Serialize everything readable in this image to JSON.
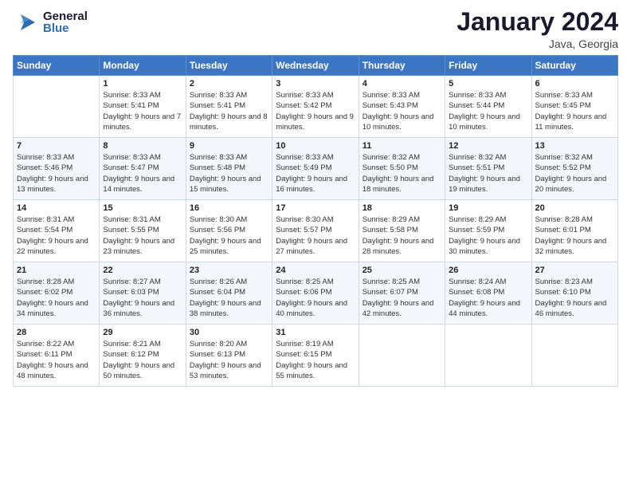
{
  "header": {
    "logo_general": "General",
    "logo_blue": "Blue",
    "month_title": "January 2024",
    "subtitle": "Java, Georgia"
  },
  "weekdays": [
    "Sunday",
    "Monday",
    "Tuesday",
    "Wednesday",
    "Thursday",
    "Friday",
    "Saturday"
  ],
  "weeks": [
    [
      {
        "day": "",
        "sunrise": "",
        "sunset": "",
        "daylight": ""
      },
      {
        "day": "1",
        "sunrise": "Sunrise: 8:33 AM",
        "sunset": "Sunset: 5:41 PM",
        "daylight": "Daylight: 9 hours and 7 minutes."
      },
      {
        "day": "2",
        "sunrise": "Sunrise: 8:33 AM",
        "sunset": "Sunset: 5:41 PM",
        "daylight": "Daylight: 9 hours and 8 minutes."
      },
      {
        "day": "3",
        "sunrise": "Sunrise: 8:33 AM",
        "sunset": "Sunset: 5:42 PM",
        "daylight": "Daylight: 9 hours and 9 minutes."
      },
      {
        "day": "4",
        "sunrise": "Sunrise: 8:33 AM",
        "sunset": "Sunset: 5:43 PM",
        "daylight": "Daylight: 9 hours and 10 minutes."
      },
      {
        "day": "5",
        "sunrise": "Sunrise: 8:33 AM",
        "sunset": "Sunset: 5:44 PM",
        "daylight": "Daylight: 9 hours and 10 minutes."
      },
      {
        "day": "6",
        "sunrise": "Sunrise: 8:33 AM",
        "sunset": "Sunset: 5:45 PM",
        "daylight": "Daylight: 9 hours and 11 minutes."
      }
    ],
    [
      {
        "day": "7",
        "sunrise": "Sunrise: 8:33 AM",
        "sunset": "Sunset: 5:46 PM",
        "daylight": "Daylight: 9 hours and 13 minutes."
      },
      {
        "day": "8",
        "sunrise": "Sunrise: 8:33 AM",
        "sunset": "Sunset: 5:47 PM",
        "daylight": "Daylight: 9 hours and 14 minutes."
      },
      {
        "day": "9",
        "sunrise": "Sunrise: 8:33 AM",
        "sunset": "Sunset: 5:48 PM",
        "daylight": "Daylight: 9 hours and 15 minutes."
      },
      {
        "day": "10",
        "sunrise": "Sunrise: 8:33 AM",
        "sunset": "Sunset: 5:49 PM",
        "daylight": "Daylight: 9 hours and 16 minutes."
      },
      {
        "day": "11",
        "sunrise": "Sunrise: 8:32 AM",
        "sunset": "Sunset: 5:50 PM",
        "daylight": "Daylight: 9 hours and 18 minutes."
      },
      {
        "day": "12",
        "sunrise": "Sunrise: 8:32 AM",
        "sunset": "Sunset: 5:51 PM",
        "daylight": "Daylight: 9 hours and 19 minutes."
      },
      {
        "day": "13",
        "sunrise": "Sunrise: 8:32 AM",
        "sunset": "Sunset: 5:52 PM",
        "daylight": "Daylight: 9 hours and 20 minutes."
      }
    ],
    [
      {
        "day": "14",
        "sunrise": "Sunrise: 8:31 AM",
        "sunset": "Sunset: 5:54 PM",
        "daylight": "Daylight: 9 hours and 22 minutes."
      },
      {
        "day": "15",
        "sunrise": "Sunrise: 8:31 AM",
        "sunset": "Sunset: 5:55 PM",
        "daylight": "Daylight: 9 hours and 23 minutes."
      },
      {
        "day": "16",
        "sunrise": "Sunrise: 8:30 AM",
        "sunset": "Sunset: 5:56 PM",
        "daylight": "Daylight: 9 hours and 25 minutes."
      },
      {
        "day": "17",
        "sunrise": "Sunrise: 8:30 AM",
        "sunset": "Sunset: 5:57 PM",
        "daylight": "Daylight: 9 hours and 27 minutes."
      },
      {
        "day": "18",
        "sunrise": "Sunrise: 8:29 AM",
        "sunset": "Sunset: 5:58 PM",
        "daylight": "Daylight: 9 hours and 28 minutes."
      },
      {
        "day": "19",
        "sunrise": "Sunrise: 8:29 AM",
        "sunset": "Sunset: 5:59 PM",
        "daylight": "Daylight: 9 hours and 30 minutes."
      },
      {
        "day": "20",
        "sunrise": "Sunrise: 8:28 AM",
        "sunset": "Sunset: 6:01 PM",
        "daylight": "Daylight: 9 hours and 32 minutes."
      }
    ],
    [
      {
        "day": "21",
        "sunrise": "Sunrise: 8:28 AM",
        "sunset": "Sunset: 6:02 PM",
        "daylight": "Daylight: 9 hours and 34 minutes."
      },
      {
        "day": "22",
        "sunrise": "Sunrise: 8:27 AM",
        "sunset": "Sunset: 6:03 PM",
        "daylight": "Daylight: 9 hours and 36 minutes."
      },
      {
        "day": "23",
        "sunrise": "Sunrise: 8:26 AM",
        "sunset": "Sunset: 6:04 PM",
        "daylight": "Daylight: 9 hours and 38 minutes."
      },
      {
        "day": "24",
        "sunrise": "Sunrise: 8:25 AM",
        "sunset": "Sunset: 6:06 PM",
        "daylight": "Daylight: 9 hours and 40 minutes."
      },
      {
        "day": "25",
        "sunrise": "Sunrise: 8:25 AM",
        "sunset": "Sunset: 6:07 PM",
        "daylight": "Daylight: 9 hours and 42 minutes."
      },
      {
        "day": "26",
        "sunrise": "Sunrise: 8:24 AM",
        "sunset": "Sunset: 6:08 PM",
        "daylight": "Daylight: 9 hours and 44 minutes."
      },
      {
        "day": "27",
        "sunrise": "Sunrise: 8:23 AM",
        "sunset": "Sunset: 6:10 PM",
        "daylight": "Daylight: 9 hours and 46 minutes."
      }
    ],
    [
      {
        "day": "28",
        "sunrise": "Sunrise: 8:22 AM",
        "sunset": "Sunset: 6:11 PM",
        "daylight": "Daylight: 9 hours and 48 minutes."
      },
      {
        "day": "29",
        "sunrise": "Sunrise: 8:21 AM",
        "sunset": "Sunset: 6:12 PM",
        "daylight": "Daylight: 9 hours and 50 minutes."
      },
      {
        "day": "30",
        "sunrise": "Sunrise: 8:20 AM",
        "sunset": "Sunset: 6:13 PM",
        "daylight": "Daylight: 9 hours and 53 minutes."
      },
      {
        "day": "31",
        "sunrise": "Sunrise: 8:19 AM",
        "sunset": "Sunset: 6:15 PM",
        "daylight": "Daylight: 9 hours and 55 minutes."
      },
      {
        "day": "",
        "sunrise": "",
        "sunset": "",
        "daylight": ""
      },
      {
        "day": "",
        "sunrise": "",
        "sunset": "",
        "daylight": ""
      },
      {
        "day": "",
        "sunrise": "",
        "sunset": "",
        "daylight": ""
      }
    ]
  ]
}
